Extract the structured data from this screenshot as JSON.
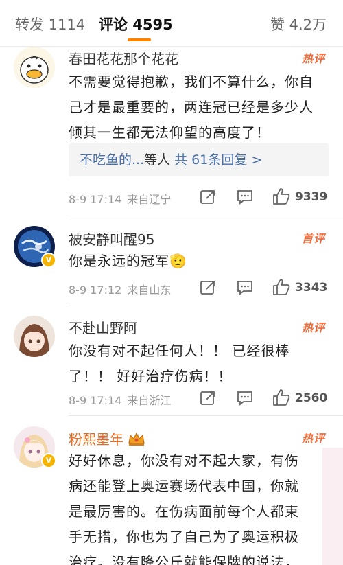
{
  "tabs": {
    "reposts": "转发 1114",
    "comments": "评论 4595",
    "likes": "赞 4.2万"
  },
  "comments": [
    {
      "name": "春田花花那个花花",
      "tag": "热评",
      "lines": [
        "不需要觉得抱歉，我们不算什么，你自",
        "己才是最重要的，两连冠已经是多少人",
        "倾其一生都无法仰望的高度了！"
      ],
      "reply_who": "不吃鱼的...",
      "reply_etc": "等人",
      "reply_count": "共 61条回复 >",
      "time": "8-9 17:14",
      "location": "来自辽宁",
      "likes": "9339"
    },
    {
      "name": "被安静叫醒95",
      "tag": "首评",
      "verified": "V",
      "lines": [
        "你是永远的冠军🫡"
      ],
      "time": "8-9 17:12",
      "location": "来自山东",
      "likes": "3343"
    },
    {
      "name": "不赴山野阿",
      "tag": "热评",
      "lines": [
        "你没有对不起任何人！！ 已经很棒",
        "了！！ 好好治疗伤病！！"
      ],
      "time": "8-9 17:14",
      "location": "来自浙江",
      "likes": "2560"
    },
    {
      "name": "粉熙墨年",
      "tag": "热评",
      "verified": "V",
      "lines": [
        "好好休息，你没有对不起大家，有伤",
        "病还能登上奥运赛场代表中国，你就",
        "是最厉害的。在伤病面前每个人都束",
        "手无措，你也为了自己为了奥运积极",
        "治疗。没有降公斤就能保牌的说法，"
      ]
    }
  ],
  "colors": {
    "accent": "#ff8200",
    "hot": "#f26b3a",
    "link": "#4a6fa5",
    "vip_name": "#e86a1c"
  }
}
